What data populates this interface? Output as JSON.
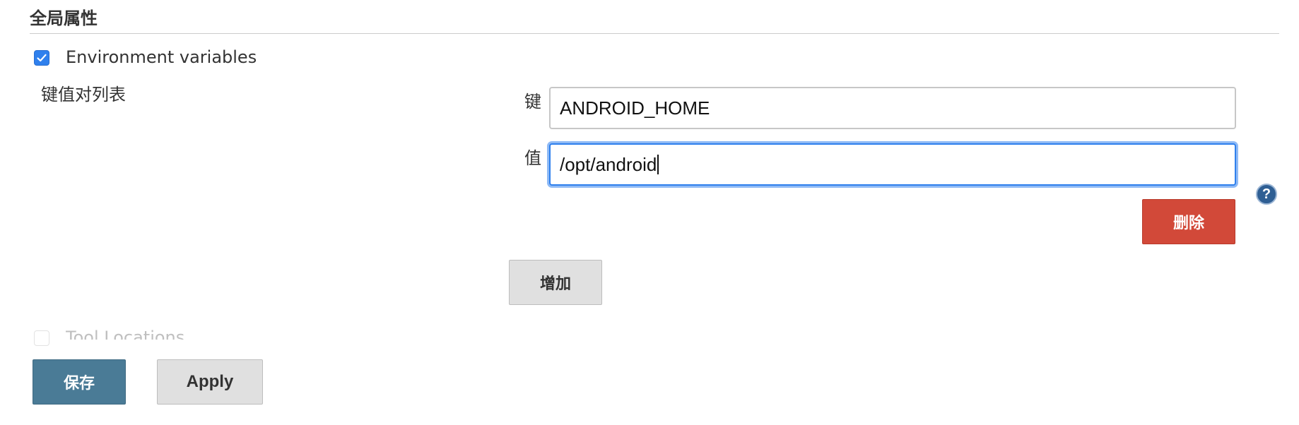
{
  "section": {
    "title": "全局属性"
  },
  "env_vars": {
    "checked": true,
    "label": "Environment variables",
    "list_label": "键值对列表",
    "entry": {
      "key_label": "键",
      "key_value": "ANDROID_HOME",
      "value_label": "值",
      "value_value": "/opt/android"
    },
    "delete_label": "删除",
    "add_label": "增加",
    "help_glyph": "?"
  },
  "tool_locations": {
    "checked": false,
    "label": "Tool Locations"
  },
  "footer": {
    "save_label": "保存",
    "apply_label": "Apply"
  },
  "colors": {
    "delete_button": "#d24939",
    "save_button": "#4a7b96",
    "focus_ring": "#2f80ed",
    "checkbox_checked": "#2f80ed"
  }
}
